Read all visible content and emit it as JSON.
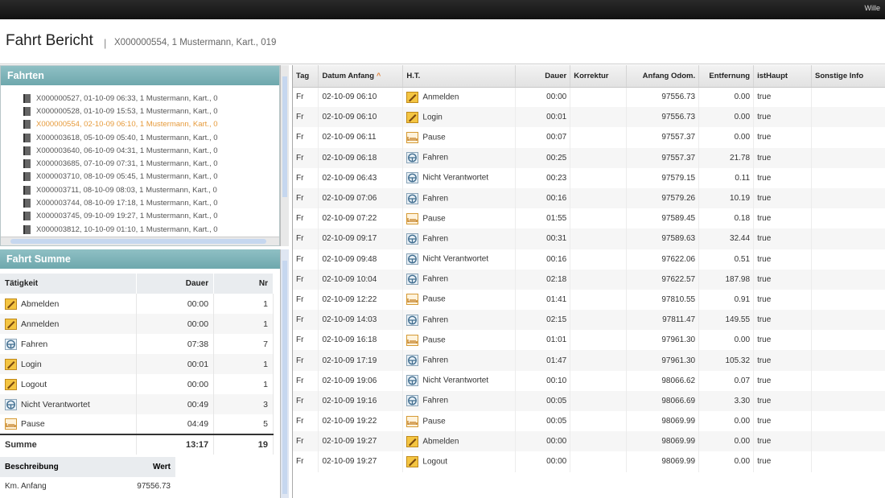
{
  "topbar": {
    "user": "Wille"
  },
  "header": {
    "title": "Fahrt Bericht",
    "separator": "|",
    "subtitle": "X000000554, 1 Mustermann, Kart., 019"
  },
  "fahrten": {
    "title": "Fahrten",
    "items": [
      {
        "label": "X000000527, 01-10-09 06:33, 1 Mustermann, Kart., 0"
      },
      {
        "label": "X000000528, 01-10-09 15:53, 1 Mustermann, Kart., 0"
      },
      {
        "label": "X000000554, 02-10-09 06:10, 1 Mustermann, Kart., 0",
        "selected": true
      },
      {
        "label": "X000003618, 05-10-09 05:40, 1 Mustermann, Kart., 0"
      },
      {
        "label": "X000003640, 06-10-09 04:31, 1 Mustermann, Kart., 0"
      },
      {
        "label": "X000003685, 07-10-09 07:31, 1 Mustermann, Kart., 0"
      },
      {
        "label": "X000003710, 08-10-09 05:45, 1 Mustermann, Kart., 0"
      },
      {
        "label": "X000003711, 08-10-09 08:03, 1 Mustermann, Kart., 0"
      },
      {
        "label": "X000003744, 08-10-09 17:18, 1 Mustermann, Kart., 0"
      },
      {
        "label": "X000003745, 09-10-09 19:27, 1 Mustermann, Kart., 0"
      },
      {
        "label": "X000003812, 10-10-09 01:10, 1 Mustermann, Kart., 0"
      }
    ]
  },
  "summe": {
    "title": "Fahrt Summe",
    "headers": {
      "activity": "Tätigkeit",
      "duration": "Dauer",
      "nr": "Nr"
    },
    "rows": [
      {
        "icon": "pencil-icon",
        "activity": "Abmelden",
        "duration": "00:00",
        "nr": "1"
      },
      {
        "icon": "pencil-icon",
        "activity": "Anmelden",
        "duration": "00:00",
        "nr": "1"
      },
      {
        "icon": "steering-wheel-icon",
        "activity": "Fahren",
        "duration": "07:38",
        "nr": "7"
      },
      {
        "icon": "pencil-icon",
        "activity": "Login",
        "duration": "00:01",
        "nr": "1"
      },
      {
        "icon": "pencil-icon",
        "activity": "Logout",
        "duration": "00:00",
        "nr": "1"
      },
      {
        "icon": "steering-wheel-icon",
        "activity": "Nicht Verantwortet",
        "duration": "00:49",
        "nr": "3"
      },
      {
        "icon": "bed-icon",
        "activity": "Pause",
        "duration": "04:49",
        "nr": "5"
      }
    ],
    "total": {
      "label": "Summe",
      "duration": "13:17",
      "nr": "19"
    },
    "desc_headers": {
      "desc": "Beschreibung",
      "value": "Wert"
    },
    "desc_rows": [
      {
        "desc": "Km. Anfang",
        "value": "97556.73"
      }
    ]
  },
  "main": {
    "headers": {
      "tag": "Tag",
      "date": "Datum Anfang",
      "sort_indicator": "^",
      "ht": "H.T.",
      "duration": "Dauer",
      "correction": "Korrektur",
      "odo": "Anfang Odom.",
      "distance": "Entfernung",
      "ist_haupt": "istHaupt",
      "info": "Sonstige Info"
    },
    "rows": [
      {
        "tag": "Fr",
        "date": "02-10-09 06:10",
        "icon": "pencil-icon",
        "ht": "Anmelden",
        "duration": "00:00",
        "correction": "",
        "odo": "97556.73",
        "distance": "0.00",
        "ist_haupt": "true",
        "info": ""
      },
      {
        "tag": "Fr",
        "date": "02-10-09 06:10",
        "icon": "pencil-icon",
        "ht": "Login",
        "duration": "00:01",
        "correction": "",
        "odo": "97556.73",
        "distance": "0.00",
        "ist_haupt": "true",
        "info": ""
      },
      {
        "tag": "Fr",
        "date": "02-10-09 06:11",
        "icon": "bed-icon",
        "ht": "Pause",
        "duration": "00:07",
        "correction": "",
        "odo": "97557.37",
        "distance": "0.00",
        "ist_haupt": "true",
        "info": ""
      },
      {
        "tag": "Fr",
        "date": "02-10-09 06:18",
        "icon": "steering-wheel-icon",
        "ht": "Fahren",
        "duration": "00:25",
        "correction": "",
        "odo": "97557.37",
        "distance": "21.78",
        "ist_haupt": "true",
        "info": ""
      },
      {
        "tag": "Fr",
        "date": "02-10-09 06:43",
        "icon": "steering-wheel-icon",
        "ht": "Nicht Verantwortet",
        "duration": "00:23",
        "correction": "",
        "odo": "97579.15",
        "distance": "0.11",
        "ist_haupt": "true",
        "info": ""
      },
      {
        "tag": "Fr",
        "date": "02-10-09 07:06",
        "icon": "steering-wheel-icon",
        "ht": "Fahren",
        "duration": "00:16",
        "correction": "",
        "odo": "97579.26",
        "distance": "10.19",
        "ist_haupt": "true",
        "info": ""
      },
      {
        "tag": "Fr",
        "date": "02-10-09 07:22",
        "icon": "bed-icon",
        "ht": "Pause",
        "duration": "01:55",
        "correction": "",
        "odo": "97589.45",
        "distance": "0.18",
        "ist_haupt": "true",
        "info": ""
      },
      {
        "tag": "Fr",
        "date": "02-10-09 09:17",
        "icon": "steering-wheel-icon",
        "ht": "Fahren",
        "duration": "00:31",
        "correction": "",
        "odo": "97589.63",
        "distance": "32.44",
        "ist_haupt": "true",
        "info": ""
      },
      {
        "tag": "Fr",
        "date": "02-10-09 09:48",
        "icon": "steering-wheel-icon",
        "ht": "Nicht Verantwortet",
        "duration": "00:16",
        "correction": "",
        "odo": "97622.06",
        "distance": "0.51",
        "ist_haupt": "true",
        "info": ""
      },
      {
        "tag": "Fr",
        "date": "02-10-09 10:04",
        "icon": "steering-wheel-icon",
        "ht": "Fahren",
        "duration": "02:18",
        "correction": "",
        "odo": "97622.57",
        "distance": "187.98",
        "ist_haupt": "true",
        "info": ""
      },
      {
        "tag": "Fr",
        "date": "02-10-09 12:22",
        "icon": "bed-icon",
        "ht": "Pause",
        "duration": "01:41",
        "correction": "",
        "odo": "97810.55",
        "distance": "0.91",
        "ist_haupt": "true",
        "info": ""
      },
      {
        "tag": "Fr",
        "date": "02-10-09 14:03",
        "icon": "steering-wheel-icon",
        "ht": "Fahren",
        "duration": "02:15",
        "correction": "",
        "odo": "97811.47",
        "distance": "149.55",
        "ist_haupt": "true",
        "info": ""
      },
      {
        "tag": "Fr",
        "date": "02-10-09 16:18",
        "icon": "bed-icon",
        "ht": "Pause",
        "duration": "01:01",
        "correction": "",
        "odo": "97961.30",
        "distance": "0.00",
        "ist_haupt": "true",
        "info": ""
      },
      {
        "tag": "Fr",
        "date": "02-10-09 17:19",
        "icon": "steering-wheel-icon",
        "ht": "Fahren",
        "duration": "01:47",
        "correction": "",
        "odo": "97961.30",
        "distance": "105.32",
        "ist_haupt": "true",
        "info": ""
      },
      {
        "tag": "Fr",
        "date": "02-10-09 19:06",
        "icon": "steering-wheel-icon",
        "ht": "Nicht Verantwortet",
        "duration": "00:10",
        "correction": "",
        "odo": "98066.62",
        "distance": "0.07",
        "ist_haupt": "true",
        "info": ""
      },
      {
        "tag": "Fr",
        "date": "02-10-09 19:16",
        "icon": "steering-wheel-icon",
        "ht": "Fahren",
        "duration": "00:05",
        "correction": "",
        "odo": "98066.69",
        "distance": "3.30",
        "ist_haupt": "true",
        "info": ""
      },
      {
        "tag": "Fr",
        "date": "02-10-09 19:22",
        "icon": "bed-icon",
        "ht": "Pause",
        "duration": "00:05",
        "correction": "",
        "odo": "98069.99",
        "distance": "0.00",
        "ist_haupt": "true",
        "info": ""
      },
      {
        "tag": "Fr",
        "date": "02-10-09 19:27",
        "icon": "pencil-icon",
        "ht": "Abmelden",
        "duration": "00:00",
        "correction": "",
        "odo": "98069.99",
        "distance": "0.00",
        "ist_haupt": "true",
        "info": ""
      },
      {
        "tag": "Fr",
        "date": "02-10-09 19:27",
        "icon": "pencil-icon",
        "ht": "Logout",
        "duration": "00:00",
        "correction": "",
        "odo": "98069.99",
        "distance": "0.00",
        "ist_haupt": "true",
        "info": ""
      }
    ]
  }
}
